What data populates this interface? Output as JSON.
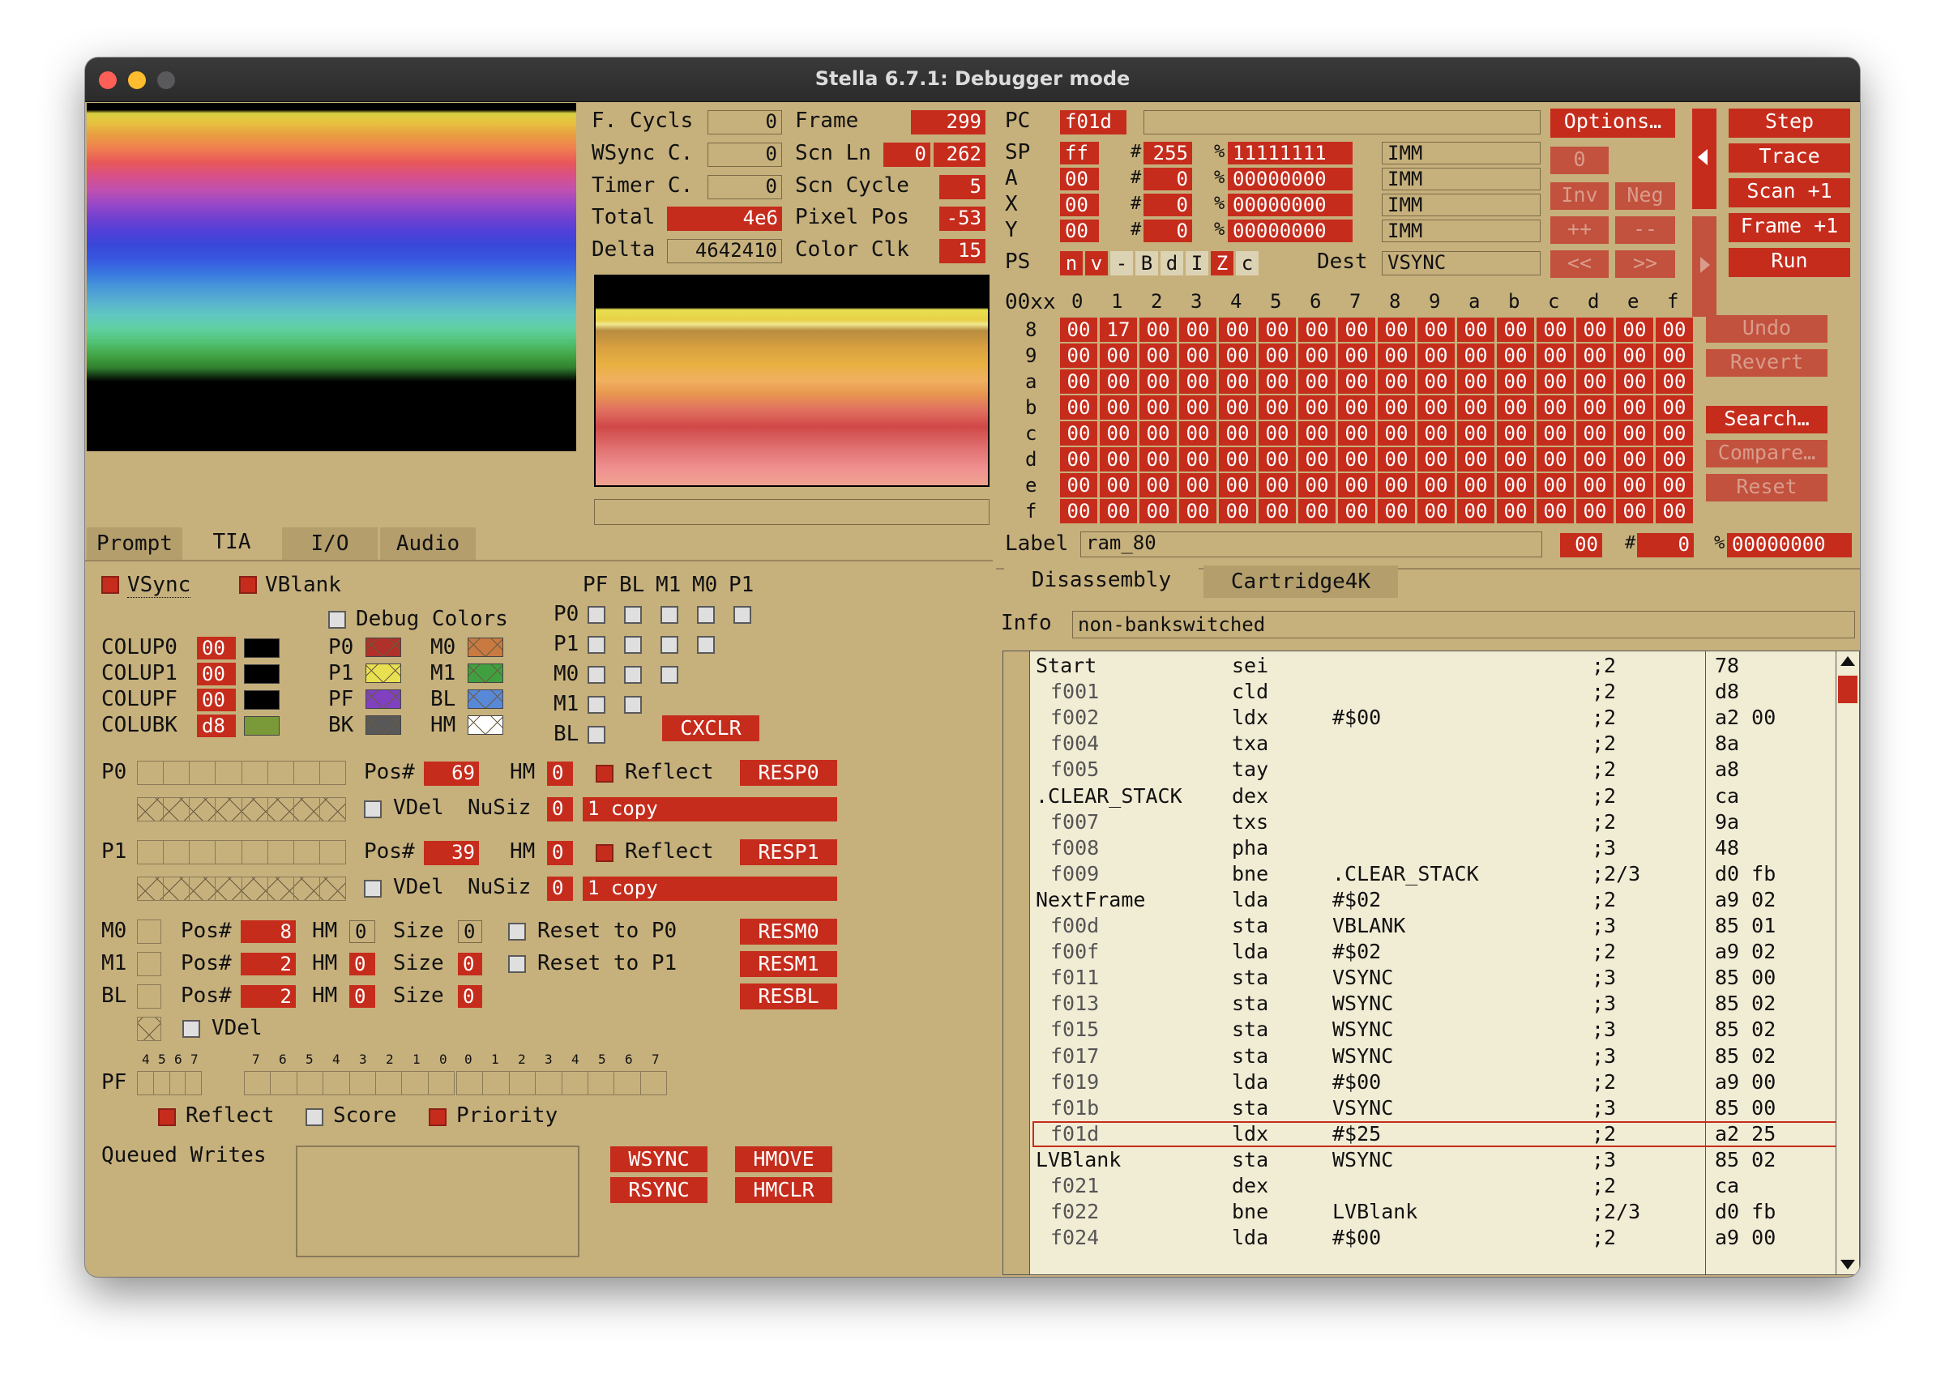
{
  "window": {
    "title": "Stella 6.7.1: Debugger mode"
  },
  "tia_info": {
    "f_cycls_label": "F. Cycls",
    "f_cycls": "0",
    "wsync_label": "WSync C.",
    "wsync": "0",
    "timer_label": "Timer C.",
    "timer": "0",
    "total_label": "Total",
    "total": "4e6",
    "delta_label": "Delta",
    "delta": "4642410",
    "frame_label": "Frame",
    "frame": "299",
    "scnln_label": "Scn Ln",
    "scnln_a": "0",
    "scnln_b": "262",
    "scncycle_label": "Scn Cycle",
    "scncycle": "5",
    "pixelpos_label": "Pixel Pos",
    "pixelpos": "-53",
    "colorclk_label": "Color Clk",
    "colorclk": "15"
  },
  "cpu": {
    "pc_label": "PC",
    "pc": "f01d",
    "sp_label": "SP",
    "sp": "ff",
    "sp_dec": "255",
    "sp_bin": "11111111",
    "a_label": "A",
    "a": "00",
    "a_dec": "0",
    "a_bin": "00000000",
    "x_label": "X",
    "x": "00",
    "x_dec": "0",
    "x_bin": "00000000",
    "y_label": "Y",
    "y": "00",
    "y_dec": "0",
    "y_bin": "00000000",
    "hash": "#",
    "pct": "%",
    "mode": "IMM",
    "ps_label": "PS",
    "flags": [
      "n",
      "v",
      "-",
      "B",
      "d",
      "I",
      "Z",
      "c"
    ],
    "dest_label": "Dest",
    "dest": "VSYNC"
  },
  "buttons": {
    "options": "Options…",
    "zero": "0",
    "inv": "Inv",
    "neg": "Neg",
    "plusplus": "++",
    "minusminus": "--",
    "shl": "<<",
    "shr": ">>",
    "step": "Step",
    "trace": "Trace",
    "scan": "Scan +1",
    "frame": "Frame +1",
    "run": "Run",
    "undo": "Undo",
    "revert": "Revert",
    "search": "Search…",
    "compare": "Compare…",
    "reset": "Reset"
  },
  "ram": {
    "header": "00xx",
    "cols": [
      "0",
      "1",
      "2",
      "3",
      "4",
      "5",
      "6",
      "7",
      "8",
      "9",
      "a",
      "b",
      "c",
      "d",
      "e",
      "f"
    ],
    "rows": [
      {
        "label": "8",
        "cells": [
          "00",
          "17",
          "00",
          "00",
          "00",
          "00",
          "00",
          "00",
          "00",
          "00",
          "00",
          "00",
          "00",
          "00",
          "00",
          "00"
        ]
      },
      {
        "label": "9",
        "cells": [
          "00",
          "00",
          "00",
          "00",
          "00",
          "00",
          "00",
          "00",
          "00",
          "00",
          "00",
          "00",
          "00",
          "00",
          "00",
          "00"
        ]
      },
      {
        "label": "a",
        "cells": [
          "00",
          "00",
          "00",
          "00",
          "00",
          "00",
          "00",
          "00",
          "00",
          "00",
          "00",
          "00",
          "00",
          "00",
          "00",
          "00"
        ]
      },
      {
        "label": "b",
        "cells": [
          "00",
          "00",
          "00",
          "00",
          "00",
          "00",
          "00",
          "00",
          "00",
          "00",
          "00",
          "00",
          "00",
          "00",
          "00",
          "00"
        ]
      },
      {
        "label": "c",
        "cells": [
          "00",
          "00",
          "00",
          "00",
          "00",
          "00",
          "00",
          "00",
          "00",
          "00",
          "00",
          "00",
          "00",
          "00",
          "00",
          "00"
        ]
      },
      {
        "label": "d",
        "cells": [
          "00",
          "00",
          "00",
          "00",
          "00",
          "00",
          "00",
          "00",
          "00",
          "00",
          "00",
          "00",
          "00",
          "00",
          "00",
          "00"
        ]
      },
      {
        "label": "e",
        "cells": [
          "00",
          "00",
          "00",
          "00",
          "00",
          "00",
          "00",
          "00",
          "00",
          "00",
          "00",
          "00",
          "00",
          "00",
          "00",
          "00"
        ]
      },
      {
        "label": "f",
        "cells": [
          "00",
          "00",
          "00",
          "00",
          "00",
          "00",
          "00",
          "00",
          "00",
          "00",
          "00",
          "00",
          "00",
          "00",
          "00",
          "00"
        ]
      }
    ],
    "label_label": "Label",
    "label": "ram_80",
    "hex": "00",
    "dec": "0",
    "bin": "00000000"
  },
  "tabs_left": [
    "Prompt",
    "TIA",
    "I/O",
    "Audio"
  ],
  "tabs_right": [
    "Disassembly",
    "Cartridge4K"
  ],
  "info": {
    "label": "Info",
    "value": "non-bankswitched"
  },
  "tia": {
    "vsync": "VSync",
    "vblank": "VBlank",
    "debug_colors": "Debug Colors",
    "colup0": "COLUP0",
    "colup0_v": "00",
    "colup1": "COLUP1",
    "colup1_v": "00",
    "colupf": "COLUPF",
    "colupf_v": "00",
    "colubk": "COLUBK",
    "colubk_v": "d8",
    "dbg": [
      {
        "l": "P0",
        "color": "#b0302a"
      },
      {
        "l": "M0",
        "color": "#c87a40"
      },
      {
        "l": "P1",
        "color": "#e8e050"
      },
      {
        "l": "M1",
        "color": "#40a040"
      },
      {
        "l": "PF",
        "color": "#8040c0"
      },
      {
        "l": "BL",
        "color": "#5888d8"
      },
      {
        "l": "BK",
        "color": "#585858"
      },
      {
        "l": "HM",
        "color": "#ffffff"
      }
    ],
    "coll_cols": [
      "PF",
      "BL",
      "M1",
      "M0",
      "P1"
    ],
    "coll_rows": [
      "P0",
      "P1",
      "M0",
      "M1",
      "BL"
    ],
    "cxclr": "CXCLR",
    "p0": "P0",
    "p1": "P1",
    "pos_label": "Pos#",
    "hm_label": "HM",
    "reflect": "Reflect",
    "vdel": "VDel",
    "nusiz": "NuSiz",
    "p0_pos": "69",
    "p0_hm": "0",
    "resp0": "RESP0",
    "p0_nusiz": "0",
    "p0_copy": "1 copy",
    "p1_pos": "39",
    "p1_hm": "0",
    "resp1": "RESP1",
    "p1_nusiz": "0",
    "p1_copy": "1 copy",
    "m0": "M0",
    "m1": "M1",
    "bl": "BL",
    "size_label": "Size",
    "m0_pos": "8",
    "m0_hm": "0",
    "m0_size": "0",
    "reset_p0": "Reset to P0",
    "resm0": "RESM0",
    "m1_pos": "2",
    "m1_hm": "0",
    "m1_size": "0",
    "reset_p1": "Reset to P1",
    "resm1": "RESM1",
    "bl_pos": "2",
    "bl_hm": "0",
    "bl_size": "0",
    "resbl": "RESBL",
    "bl_vdel": "VDel",
    "pf_label": "PF",
    "pf_bits": [
      "4",
      "5",
      "6",
      "7",
      "7",
      "6",
      "5",
      "4",
      "3",
      "2",
      "1",
      "0",
      "0",
      "1",
      "2",
      "3",
      "4",
      "5",
      "6",
      "7"
    ],
    "pf_reflect": "Reflect",
    "pf_score": "Score",
    "pf_priority": "Priority",
    "queued": "Queued Writes",
    "wsync": "WSYNC",
    "rsync": "RSYNC",
    "hmove": "HMOVE",
    "hmclr": "HMCLR",
    "colors": {
      "accent": "#c62c1c",
      "bg": "#c6b07c"
    }
  },
  "disasm": [
    {
      "label": "Start",
      "addr": "",
      "mn": "sei",
      "op": "",
      "cyc": ";2",
      "bytes": "78"
    },
    {
      "label": "",
      "addr": "f001",
      "mn": "cld",
      "op": "",
      "cyc": ";2",
      "bytes": "d8"
    },
    {
      "label": "",
      "addr": "f002",
      "mn": "ldx",
      "op": "#$00",
      "cyc": ";2",
      "bytes": "a2 00"
    },
    {
      "label": "",
      "addr": "f004",
      "mn": "txa",
      "op": "",
      "cyc": ";2",
      "bytes": "8a"
    },
    {
      "label": "",
      "addr": "f005",
      "mn": "tay",
      "op": "",
      "cyc": ";2",
      "bytes": "a8"
    },
    {
      "label": ".CLEAR_STACK",
      "addr": "",
      "mn": "dex",
      "op": "",
      "cyc": ";2",
      "bytes": "ca"
    },
    {
      "label": "",
      "addr": "f007",
      "mn": "txs",
      "op": "",
      "cyc": ";2",
      "bytes": "9a"
    },
    {
      "label": "",
      "addr": "f008",
      "mn": "pha",
      "op": "",
      "cyc": ";3",
      "bytes": "48"
    },
    {
      "label": "",
      "addr": "f009",
      "mn": "bne",
      "op": ".CLEAR_STACK",
      "cyc": ";2/3",
      "bytes": "d0 fb"
    },
    {
      "label": "NextFrame",
      "addr": "",
      "mn": "lda",
      "op": "#$02",
      "cyc": ";2",
      "bytes": "a9 02"
    },
    {
      "label": "",
      "addr": "f00d",
      "mn": "sta",
      "op": "VBLANK",
      "cyc": ";3",
      "bytes": "85 01"
    },
    {
      "label": "",
      "addr": "f00f",
      "mn": "lda",
      "op": "#$02",
      "cyc": ";2",
      "bytes": "a9 02"
    },
    {
      "label": "",
      "addr": "f011",
      "mn": "sta",
      "op": "VSYNC",
      "cyc": ";3",
      "bytes": "85 00"
    },
    {
      "label": "",
      "addr": "f013",
      "mn": "sta",
      "op": "WSYNC",
      "cyc": ";3",
      "bytes": "85 02"
    },
    {
      "label": "",
      "addr": "f015",
      "mn": "sta",
      "op": "WSYNC",
      "cyc": ";3",
      "bytes": "85 02"
    },
    {
      "label": "",
      "addr": "f017",
      "mn": "sta",
      "op": "WSYNC",
      "cyc": ";3",
      "bytes": "85 02"
    },
    {
      "label": "",
      "addr": "f019",
      "mn": "lda",
      "op": "#$00",
      "cyc": ";2",
      "bytes": "a9 00"
    },
    {
      "label": "",
      "addr": "f01b",
      "mn": "sta",
      "op": "VSYNC",
      "cyc": ";3",
      "bytes": "85 00"
    },
    {
      "label": "",
      "addr": "f01d",
      "mn": "ldx",
      "op": "#$25",
      "cyc": ";2",
      "bytes": "a2 25",
      "current": true
    },
    {
      "label": "LVBlank",
      "addr": "",
      "mn": "sta",
      "op": "WSYNC",
      "cyc": ";3",
      "bytes": "85 02"
    },
    {
      "label": "",
      "addr": "f021",
      "mn": "dex",
      "op": "",
      "cyc": ";2",
      "bytes": "ca"
    },
    {
      "label": "",
      "addr": "f022",
      "mn": "bne",
      "op": "LVBlank",
      "cyc": ";2/3",
      "bytes": "d0 fb"
    },
    {
      "label": "",
      "addr": "f024",
      "mn": "lda",
      "op": "#$00",
      "cyc": ";2",
      "bytes": "a9 00"
    }
  ]
}
